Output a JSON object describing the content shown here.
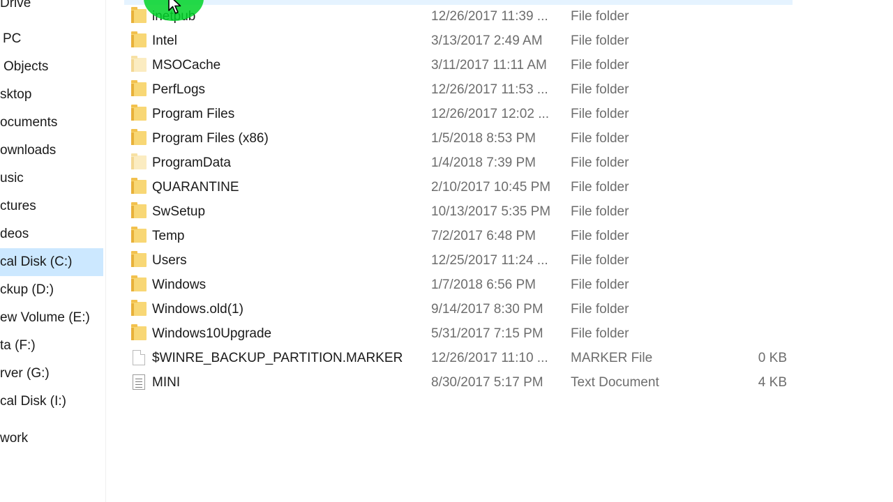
{
  "navigation": {
    "items": [
      {
        "label": "Drive",
        "selected": false
      },
      {
        "label": "PC",
        "selected": false
      },
      {
        "label": "Objects",
        "selected": false
      },
      {
        "label": "sktop",
        "selected": false
      },
      {
        "label": "ocuments",
        "selected": false
      },
      {
        "label": "ownloads",
        "selected": false
      },
      {
        "label": "usic",
        "selected": false
      },
      {
        "label": "ctures",
        "selected": false
      },
      {
        "label": "deos",
        "selected": false
      },
      {
        "label": "cal Disk (C:)",
        "selected": true
      },
      {
        "label": "ckup (D:)",
        "selected": false
      },
      {
        "label": "ew Volume (E:)",
        "selected": false
      },
      {
        "label": "ta (F:)",
        "selected": false
      },
      {
        "label": "rver (G:)",
        "selected": false
      },
      {
        "label": "cal Disk (I:)",
        "selected": false
      },
      {
        "label": "work",
        "selected": false
      }
    ]
  },
  "files": [
    {
      "name": "inetpub",
      "date": "12/26/2017 11:39 ...",
      "type": "File folder",
      "size": "",
      "icon": "folder-icon"
    },
    {
      "name": "Intel",
      "date": "3/13/2017 2:49 AM",
      "type": "File folder",
      "size": "",
      "icon": "folder-icon"
    },
    {
      "name": "MSOCache",
      "date": "3/11/2017 11:11 AM",
      "type": "File folder",
      "size": "",
      "icon": "hidden-folder-icon"
    },
    {
      "name": "PerfLogs",
      "date": "12/26/2017 11:53 ...",
      "type": "File folder",
      "size": "",
      "icon": "folder-icon"
    },
    {
      "name": "Program Files",
      "date": "12/26/2017 12:02 ...",
      "type": "File folder",
      "size": "",
      "icon": "folder-icon"
    },
    {
      "name": "Program Files (x86)",
      "date": "1/5/2018 8:53 PM",
      "type": "File folder",
      "size": "",
      "icon": "folder-icon"
    },
    {
      "name": "ProgramData",
      "date": "1/4/2018 7:39 PM",
      "type": "File folder",
      "size": "",
      "icon": "hidden-folder-icon"
    },
    {
      "name": "QUARANTINE",
      "date": "2/10/2017 10:45 PM",
      "type": "File folder",
      "size": "",
      "icon": "folder-icon"
    },
    {
      "name": "SwSetup",
      "date": "10/13/2017 5:35 PM",
      "type": "File folder",
      "size": "",
      "icon": "folder-icon"
    },
    {
      "name": "Temp",
      "date": "7/2/2017 6:48 PM",
      "type": "File folder",
      "size": "",
      "icon": "folder-icon"
    },
    {
      "name": "Users",
      "date": "12/25/2017 11:24 ...",
      "type": "File folder",
      "size": "",
      "icon": "folder-icon"
    },
    {
      "name": "Windows",
      "date": "1/7/2018 6:56 PM",
      "type": "File folder",
      "size": "",
      "icon": "folder-icon"
    },
    {
      "name": "Windows.old(1)",
      "date": "9/14/2017 8:30 PM",
      "type": "File folder",
      "size": "",
      "icon": "folder-icon"
    },
    {
      "name": "Windows10Upgrade",
      "date": "5/31/2017 7:15 PM",
      "type": "File folder",
      "size": "",
      "icon": "folder-icon"
    },
    {
      "name": "$WINRE_BACKUP_PARTITION.MARKER",
      "date": "12/26/2017 11:10 ...",
      "type": "MARKER File",
      "size": "0 KB",
      "icon": "file-icon"
    },
    {
      "name": "MINI",
      "date": "8/30/2017 5:17 PM",
      "type": "Text Document",
      "size": "4 KB",
      "icon": "text-document-icon"
    }
  ],
  "colors": {
    "selection": "#cce8ff",
    "hover": "#e5f3ff",
    "folder": "#f8d775",
    "cursor_highlight": "#00d228"
  }
}
